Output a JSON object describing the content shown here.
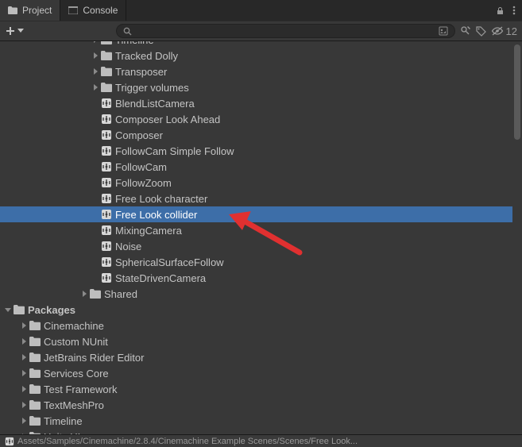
{
  "tabs": {
    "project": "Project",
    "console": "Console"
  },
  "search": {
    "placeholder": ""
  },
  "hidden_count": "12",
  "footer_path": "Assets/Samples/Cinemachine/2.8.4/Cinemachine Example Scenes/Scenes/Free Look...",
  "tree": [
    {
      "indent": 114,
      "type": "folder",
      "arrow": "right",
      "label": "Timeline"
    },
    {
      "indent": 114,
      "type": "folder",
      "arrow": "right",
      "label": "Tracked Dolly"
    },
    {
      "indent": 114,
      "type": "folder",
      "arrow": "right",
      "label": "Transposer"
    },
    {
      "indent": 114,
      "type": "folder",
      "arrow": "right",
      "label": "Trigger volumes"
    },
    {
      "indent": 114,
      "type": "scene",
      "arrow": "none",
      "label": "BlendListCamera"
    },
    {
      "indent": 114,
      "type": "scene",
      "arrow": "none",
      "label": "Composer Look Ahead"
    },
    {
      "indent": 114,
      "type": "scene",
      "arrow": "none",
      "label": "Composer"
    },
    {
      "indent": 114,
      "type": "scene",
      "arrow": "none",
      "label": "FollowCam Simple Follow"
    },
    {
      "indent": 114,
      "type": "scene",
      "arrow": "none",
      "label": "FollowCam"
    },
    {
      "indent": 114,
      "type": "scene",
      "arrow": "none",
      "label": "FollowZoom"
    },
    {
      "indent": 114,
      "type": "scene",
      "arrow": "none",
      "label": "Free Look character"
    },
    {
      "indent": 114,
      "type": "scene",
      "arrow": "none",
      "label": "Free Look collider",
      "selected": true
    },
    {
      "indent": 114,
      "type": "scene",
      "arrow": "none",
      "label": "MixingCamera"
    },
    {
      "indent": 114,
      "type": "scene",
      "arrow": "none",
      "label": "Noise"
    },
    {
      "indent": 114,
      "type": "scene",
      "arrow": "none",
      "label": "SphericalSurfaceFollow"
    },
    {
      "indent": 114,
      "type": "scene",
      "arrow": "none",
      "label": "StateDrivenCamera"
    },
    {
      "indent": 100,
      "type": "folder",
      "arrow": "right",
      "label": "Shared"
    },
    {
      "indent": 4,
      "type": "folder",
      "arrow": "down",
      "label": "Packages",
      "bold": true
    },
    {
      "indent": 24,
      "type": "folder",
      "arrow": "right",
      "label": "Cinemachine"
    },
    {
      "indent": 24,
      "type": "folder",
      "arrow": "right",
      "label": "Custom NUnit"
    },
    {
      "indent": 24,
      "type": "folder",
      "arrow": "right",
      "label": "JetBrains Rider Editor"
    },
    {
      "indent": 24,
      "type": "folder",
      "arrow": "right",
      "label": "Services Core"
    },
    {
      "indent": 24,
      "type": "folder",
      "arrow": "right",
      "label": "Test Framework"
    },
    {
      "indent": 24,
      "type": "folder",
      "arrow": "right",
      "label": "TextMeshPro"
    },
    {
      "indent": 24,
      "type": "folder",
      "arrow": "right",
      "label": "Timeline"
    },
    {
      "indent": 24,
      "type": "folder",
      "arrow": "right",
      "label": "Unity UI"
    }
  ]
}
